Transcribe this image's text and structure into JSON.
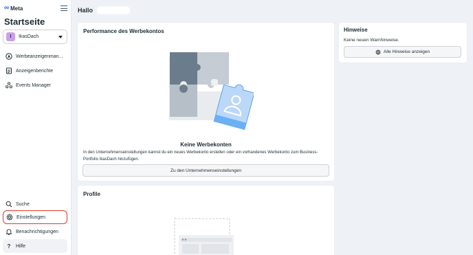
{
  "brand": {
    "logo_text": "Meta"
  },
  "sidebar": {
    "title": "Startseite",
    "account": {
      "initial": "I",
      "name": "IkasDach"
    },
    "items": [
      {
        "label": "Werbeanzeigenman...",
        "icon": "ads-manager-icon"
      },
      {
        "label": "Anzeigenberichte",
        "icon": "reports-icon"
      },
      {
        "label": "Events Manager",
        "icon": "events-manager-icon"
      }
    ],
    "bottom_items": [
      {
        "label": "Suche",
        "icon": "search-icon"
      },
      {
        "label": "Einstellungen",
        "icon": "gear-icon",
        "selected": true
      },
      {
        "label": "Benachrichtigungen",
        "icon": "bell-icon"
      },
      {
        "label": "Hilfe",
        "icon": "help-icon"
      }
    ]
  },
  "header": {
    "greeting": "Hallo"
  },
  "performance": {
    "title": "Performance des Werbekontos",
    "empty_title": "Keine Werbekonten",
    "empty_text": "In den Unternehmenseinstellungen kannst du ein neues Werbekonto erstellen oder ein vorhandenes Werbekonto zum Business-Portfolio IkasDach hinzufügen.",
    "button_label": "Zu den Unternehmenseinstellungen"
  },
  "profile": {
    "title": "Profile"
  },
  "hints": {
    "title": "Hinweise",
    "text": "Keine neuen Warnhinweise.",
    "button_label": "Alle Hinweise anzeigen"
  },
  "colors": {
    "accent": "#0866ff",
    "selected_outline": "#e0392b",
    "background": "#eef1f6"
  }
}
